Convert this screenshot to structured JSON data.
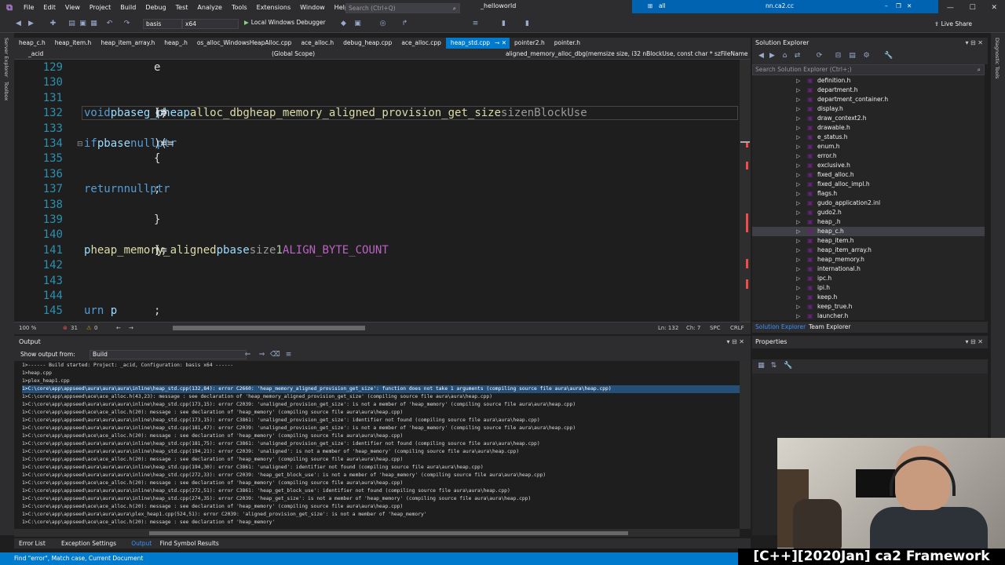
{
  "menubar": {
    "items": [
      "File",
      "Edit",
      "View",
      "Project",
      "Build",
      "Debug",
      "Test",
      "Analyze",
      "Tools",
      "Extensions",
      "Window",
      "Help"
    ],
    "search_placeholder": "Search (Ctrl+Q)",
    "solution_name": "_helloworld",
    "blue_left": "all",
    "blue_file": "nn.ca2.cc"
  },
  "toolbar": {
    "config": "basis",
    "platform": "x64",
    "debugger": "Local Windows Debugger",
    "live_share": "Live Share"
  },
  "side_tools": {
    "left": [
      "Server Explorer",
      "Toolbox"
    ],
    "right": [
      "Diagnostic Tools"
    ]
  },
  "doc_tabs": [
    "heap_c.h",
    "heap_item.h",
    "heap_item_array.h",
    "heap_.h",
    "os_alloc_WindowsHeapAlloc.cpp",
    "ace_alloc.h",
    "debug_heap.cpp",
    "ace_alloc.cpp",
    "heap_std.cpp",
    "pointer2.h",
    "pointer.h"
  ],
  "active_tab": "heap_std.cpp",
  "navbar": {
    "project": "_acid",
    "scope": "(Global Scope)",
    "member": "aligned_memory_alloc_dbg(memsize size, i32 nBlockUse, const char * szFileName"
  },
  "code_lines": [
    {
      "num": "129",
      "parts": [
        {
          "t": "e",
          "c": "cd"
        }
      ]
    },
    {
      "num": "130",
      "parts": []
    },
    {
      "num": "131",
      "parts": []
    },
    {
      "num": "132",
      "parts": [
        {
          "t": "void",
          "c": "kw"
        },
        {
          "t": " * ",
          "c": "cd"
        },
        {
          "t": "pbase",
          "c": "vr"
        },
        {
          "t": " = ",
          "c": "cd"
        },
        {
          "t": "g_pheap",
          "c": "vr"
        },
        {
          "t": "->",
          "c": "cd"
        },
        {
          "t": "alloc_dbg",
          "c": "fn"
        },
        {
          "t": "(",
          "c": "cd"
        },
        {
          "t": "heap_memory_aligned_provision_get_size",
          "c": "fn"
        },
        {
          "t": "(",
          "c": "cd"
        },
        {
          "t": "size",
          "c": "pm"
        },
        {
          "t": "), ",
          "c": "cd"
        },
        {
          "t": "nBlockUse",
          "c": "pm"
        }
      ]
    },
    {
      "num": "133",
      "parts": []
    },
    {
      "num": "134",
      "parts": [
        {
          "t": "if",
          "c": "kw"
        },
        {
          "t": " (",
          "c": "cd"
        },
        {
          "t": "pbase",
          "c": "vr"
        },
        {
          "t": " == ",
          "c": "cd"
        },
        {
          "t": "nullptr",
          "c": "kw"
        },
        {
          "t": ")",
          "c": "cd"
        }
      ]
    },
    {
      "num": "135",
      "parts": [
        {
          "t": "{",
          "c": "cd"
        }
      ]
    },
    {
      "num": "136",
      "parts": []
    },
    {
      "num": "137",
      "parts": [
        {
          "t": "    ",
          "c": "cd"
        },
        {
          "t": "return",
          "c": "kw"
        },
        {
          "t": " ",
          "c": "cd"
        },
        {
          "t": "nullptr",
          "c": "kw"
        },
        {
          "t": ";",
          "c": "cd"
        }
      ]
    },
    {
      "num": "138",
      "parts": []
    },
    {
      "num": "139",
      "parts": [
        {
          "t": "}",
          "c": "cd"
        }
      ]
    },
    {
      "num": "140",
      "parts": []
    },
    {
      "num": "141",
      "parts": [
        {
          "t": "p",
          "c": "vr"
        },
        {
          "t": " = ",
          "c": "cd"
        },
        {
          "t": "heap_memory_aligned",
          "c": "fn"
        },
        {
          "t": "(",
          "c": "cd"
        },
        {
          "t": "pbase",
          "c": "vr"
        },
        {
          "t": ", ",
          "c": "cd"
        },
        {
          "t": "size",
          "c": "pm"
        },
        {
          "t": ", ",
          "c": "cd"
        },
        {
          "t": "1",
          "c": "nm"
        },
        {
          "t": ", ",
          "c": "cd"
        },
        {
          "t": "ALIGN_BYTE_COUNT",
          "c": "mc"
        },
        {
          "t": ");",
          "c": "cd"
        }
      ]
    },
    {
      "num": "142",
      "parts": []
    },
    {
      "num": "143",
      "parts": []
    },
    {
      "num": "144",
      "parts": []
    },
    {
      "num": "145",
      "parts": [
        {
          "t": "urn ",
          "c": "kw"
        },
        {
          "t": "p",
          "c": "vr"
        },
        {
          "t": ";",
          "c": "cd"
        }
      ]
    }
  ],
  "editor_status": {
    "zoom": "100 %",
    "errors": "31",
    "warnings": "0",
    "ln": "Ln: 132",
    "ch": "Ch: 7",
    "mode": "SPC",
    "eol": "CRLF"
  },
  "solution_explorer": {
    "title": "Solution Explorer",
    "search_placeholder": "Search Solution Explorer (Ctrl+;)",
    "files": [
      "definition.h",
      "department.h",
      "department_container.h",
      "display.h",
      "draw_context2.h",
      "drawable.h",
      "e_status.h",
      "enum.h",
      "error.h",
      "exclusive.h",
      "fixed_alloc.h",
      "fixed_alloc_impl.h",
      "flags.h",
      "gudo_application2.inl",
      "gudo2.h",
      "heap_.h",
      "heap_c.h",
      "heap_item.h",
      "heap_item_array.h",
      "heap_memory.h",
      "international.h",
      "ipc.h",
      "ipi.h",
      "keep.h",
      "keep_true.h",
      "launcher.h"
    ],
    "selected": "heap_c.h",
    "tabs": [
      "Solution Explorer",
      "Team Explorer"
    ]
  },
  "output": {
    "title": "Output",
    "show_from_label": "Show output from:",
    "source": "Build",
    "lines": [
      "1>------ Build started: Project: _acid, Configuration: basis x64 ------",
      "1>heap.cpp",
      "1>plex_heap1.cpp",
      "1>C:\\core\\app\\appseed\\aura\\aura\\aura\\inline\\heap_std.cpp(132,84): error C2660: 'heap_memory_aligned_provision_get_size': function does not take 1 arguments (compiling source file aura\\aura\\heap.cpp)",
      "1>C:\\core\\app\\appseed\\ace\\ace_alloc.h(43,23): message : see declaration of 'heap_memory_aligned_provision_get_size' (compiling source file aura\\aura\\heap.cpp)",
      "1>C:\\core\\app\\appseed\\aura\\aura\\aura\\inline\\heap_std.cpp(173,15): error C2039: 'unaligned_provision_get_size': is not a member of 'heap_memory' (compiling source file aura\\aura\\heap.cpp)",
      "1>C:\\core\\app\\appseed\\ace\\ace_alloc.h(20): message : see declaration of 'heap_memory' (compiling source file aura\\aura\\heap.cpp)",
      "1>C:\\core\\app\\appseed\\aura\\aura\\aura\\inline\\heap_std.cpp(173,15): error C3861: 'unaligned_provision_get_size': identifier not found (compiling source file aura\\aura\\heap.cpp)",
      "1>C:\\core\\app\\appseed\\aura\\aura\\aura\\inline\\heap_std.cpp(181,47): error C2039: 'unaligned_provision_get_size': is not a member of 'heap_memory' (compiling source file aura\\aura\\heap.cpp)",
      "1>C:\\core\\app\\appseed\\ace\\ace_alloc.h(20): message : see declaration of 'heap_memory' (compiling source file aura\\aura\\heap.cpp)",
      "1>C:\\core\\app\\appseed\\aura\\aura\\aura\\inline\\heap_std.cpp(181,75): error C3861: 'unaligned_provision_get_size': identifier not found (compiling source file aura\\aura\\heap.cpp)",
      "1>C:\\core\\app\\appseed\\aura\\aura\\aura\\inline\\heap_std.cpp(194,21): error C2039: 'unaligned': is not a member of 'heap_memory' (compiling source file aura\\aura\\heap.cpp)",
      "1>C:\\core\\app\\appseed\\ace\\ace_alloc.h(20): message : see declaration of 'heap_memory' (compiling source file aura\\aura\\heap.cpp)",
      "1>C:\\core\\app\\appseed\\aura\\aura\\aura\\inline\\heap_std.cpp(194,30): error C3861: 'unaligned': identifier not found (compiling source file aura\\aura\\heap.cpp)",
      "1>C:\\core\\app\\appseed\\aura\\aura\\aura\\inline\\heap_std.cpp(272,33): error C2039: 'heap_get_block_use': is not a member of 'heap_memory' (compiling source file aura\\aura\\heap.cpp)",
      "1>C:\\core\\app\\appseed\\ace\\ace_alloc.h(20): message : see declaration of 'heap_memory' (compiling source file aura\\aura\\heap.cpp)",
      "1>C:\\core\\app\\appseed\\aura\\aura\\aura\\inline\\heap_std.cpp(272,51): error C3861: 'heap_get_block_use': identifier not found (compiling source file aura\\aura\\heap.cpp)",
      "1>C:\\core\\app\\appseed\\aura\\aura\\aura\\inline\\heap_std.cpp(274,35): error C2039: 'heap_get_size': is not a member of 'heap_memory' (compiling source file aura\\aura\\heap.cpp)",
      "1>C:\\core\\app\\appseed\\ace\\ace_alloc.h(20): message : see declaration of 'heap_memory' (compiling source file aura\\aura\\heap.cpp)",
      "1>C:\\core\\app\\appseed\\aura\\aura\\aura\\plex_heap1.cpp(524,51): error C2039: 'aligned_provision_get_size': is not a member of 'heap_memory'",
      "1>C:\\core\\app\\appseed\\ace\\ace_alloc.h(20): message : see declaration of 'heap_memory'"
    ],
    "highlighted_index": 3
  },
  "bottom_tabs": [
    "Error List",
    "Exception Settings",
    "Output",
    "Find Symbol Results"
  ],
  "active_bottom_tab": "Output",
  "properties": {
    "title": "Properties"
  },
  "status": "Find \"error\", Match case, Current Document",
  "video_title": "[C++][2020Jan] ca2 Framework"
}
